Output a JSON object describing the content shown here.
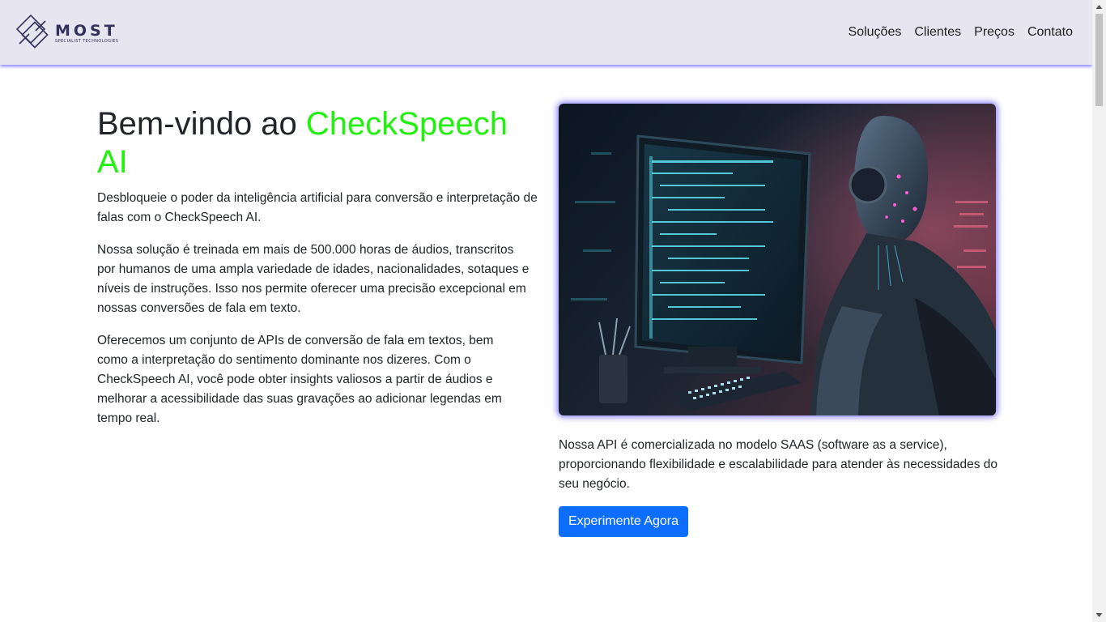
{
  "header": {
    "logo": {
      "name": "MOST",
      "tagline": "SPECIALIST TECHNOLOGIES"
    },
    "nav": [
      {
        "label": "Soluções"
      },
      {
        "label": "Clientes"
      },
      {
        "label": "Preços"
      },
      {
        "label": "Contato"
      }
    ]
  },
  "hero": {
    "title_prefix": "Bem-vindo ao ",
    "title_accent": "CheckSpeech AI",
    "paragraphs": [
      "Desbloqueie o poder da inteligência artificial para conversão e interpretação de falas com o CheckSpeech AI.",
      "Nossa solução é treinada em mais de 500.000 horas de áudios, transcritos por humanos de uma ampla variedade de idades, nacionalidades, sotaques e níveis de instruções. Isso nos permite oferecer uma precisão excepcional em nossas conversões de fala em texto.",
      "Oferecemos um conjunto de APIs de conversão de fala em textos, bem como a interpretação do sentimento dominante nos dizeres. Com o CheckSpeech AI, você pode obter insights valiosos a partir de áudios e melhorar a acessibilidade das suas gravações ao adicionar legendas em tempo real."
    ],
    "side_text": "Nossa API é comercializada no modelo SAAS (software as a service), proporcionando flexibilidade e escalabilidade para atender às necessidades do seu negócio.",
    "cta_label": "Experimente Agora"
  },
  "colors": {
    "accent": "#22f00e",
    "nav_bg": "#e6e5f0",
    "nav_shadow": "#5a50ff",
    "button": "#0d6efd"
  },
  "icons": {
    "logo": "diamond-logo-icon",
    "image": "ai-robot-computer-illustration"
  }
}
